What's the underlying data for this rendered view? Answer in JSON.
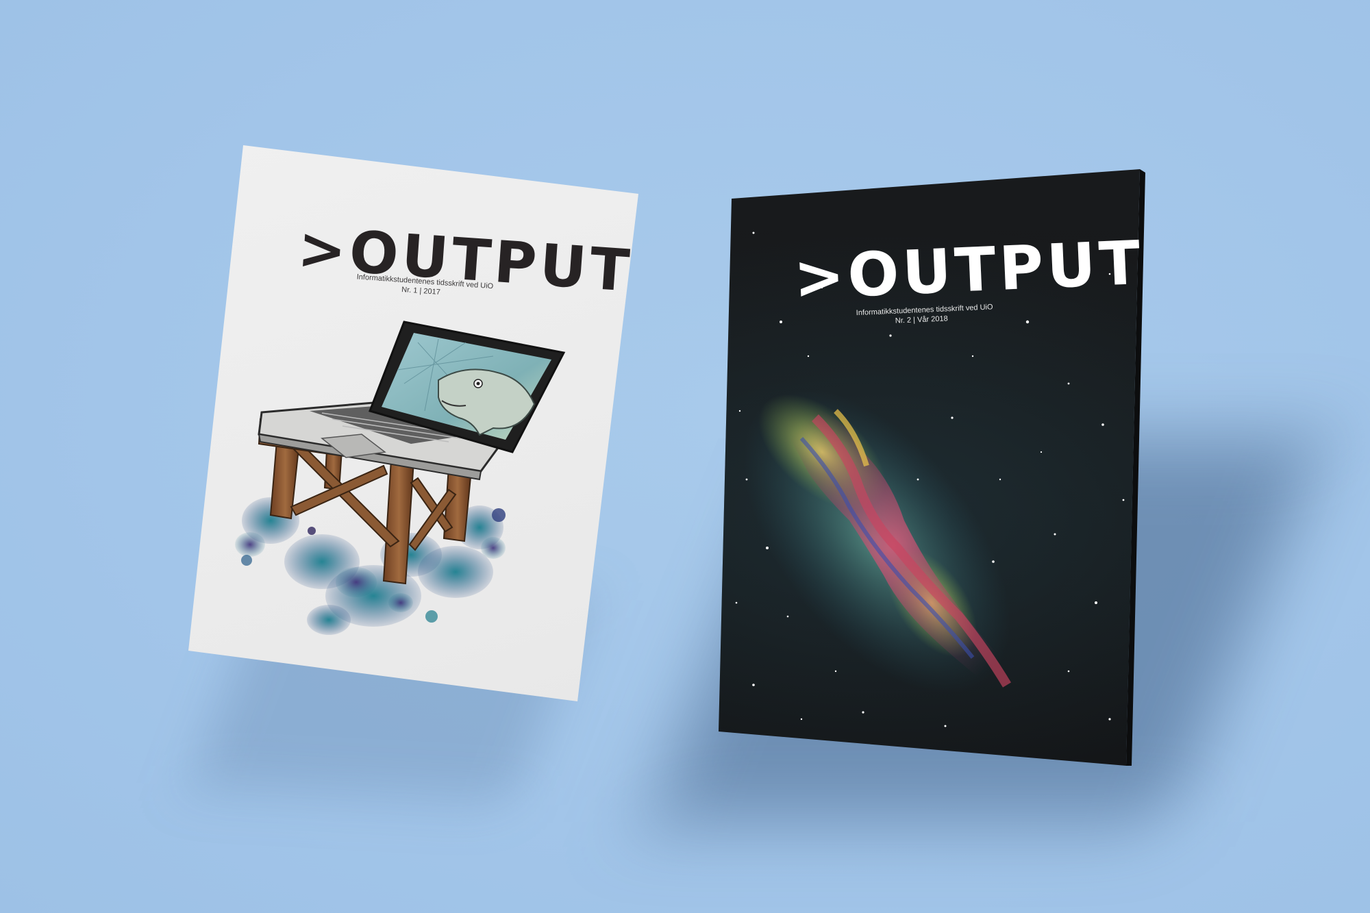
{
  "scene": {
    "background_color": "#a4c7ea"
  },
  "covers": [
    {
      "logo": ">OUTPUT",
      "subtitle": "Informatikkstudentenes tidsskrift ved UiO",
      "issue": "Nr. 1 | 2017",
      "cover_color": "#eeeeee",
      "artwork": "laptop-on-wooden-table-with-fish-on-screen"
    },
    {
      "logo": ">OUTPUT",
      "subtitle": "Informatikkstudentenes tidsskrift ved UiO",
      "issue": "Nr. 2 | Vår 2018",
      "cover_color": "#17181a",
      "artwork": "galaxy-nebula-painting"
    }
  ]
}
